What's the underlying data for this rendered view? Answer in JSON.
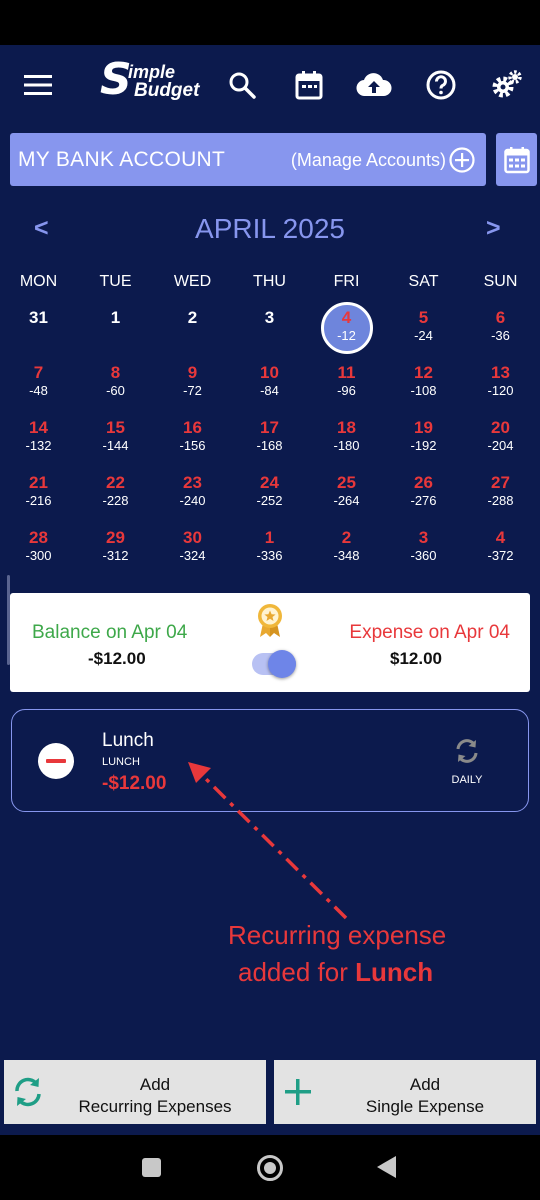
{
  "app": {
    "logo_line1": "imple",
    "logo_line2": "Budget",
    "logo_letter": "S"
  },
  "toolbar": {
    "icons": [
      "menu-icon",
      "search-icon",
      "calendar-icon",
      "cloud-upload-icon",
      "help-icon",
      "settings-icon"
    ]
  },
  "account": {
    "name": "MY BANK ACCOUNT",
    "manage_label": "(Manage Accounts)"
  },
  "calendar": {
    "month_title": "APRIL 2025",
    "prev": "<",
    "next": ">",
    "days_of_week": [
      "MON",
      "TUE",
      "WED",
      "THU",
      "FRI",
      "SAT",
      "SUN"
    ],
    "weeks": [
      [
        {
          "d": "31",
          "a": "",
          "c": "white"
        },
        {
          "d": "1",
          "a": "",
          "c": "white"
        },
        {
          "d": "2",
          "a": "",
          "c": "white"
        },
        {
          "d": "3",
          "a": "",
          "c": "white"
        },
        {
          "d": "4",
          "a": "-12",
          "c": "red",
          "today": true
        },
        {
          "d": "5",
          "a": "-24",
          "c": "red"
        },
        {
          "d": "6",
          "a": "-36",
          "c": "red"
        }
      ],
      [
        {
          "d": "7",
          "a": "-48",
          "c": "red"
        },
        {
          "d": "8",
          "a": "-60",
          "c": "red"
        },
        {
          "d": "9",
          "a": "-72",
          "c": "red"
        },
        {
          "d": "10",
          "a": "-84",
          "c": "red"
        },
        {
          "d": "11",
          "a": "-96",
          "c": "red"
        },
        {
          "d": "12",
          "a": "-108",
          "c": "red"
        },
        {
          "d": "13",
          "a": "-120",
          "c": "red"
        }
      ],
      [
        {
          "d": "14",
          "a": "-132",
          "c": "red"
        },
        {
          "d": "15",
          "a": "-144",
          "c": "red"
        },
        {
          "d": "16",
          "a": "-156",
          "c": "red"
        },
        {
          "d": "17",
          "a": "-168",
          "c": "red"
        },
        {
          "d": "18",
          "a": "-180",
          "c": "red"
        },
        {
          "d": "19",
          "a": "-192",
          "c": "red"
        },
        {
          "d": "20",
          "a": "-204",
          "c": "red"
        }
      ],
      [
        {
          "d": "21",
          "a": "-216",
          "c": "red"
        },
        {
          "d": "22",
          "a": "-228",
          "c": "red"
        },
        {
          "d": "23",
          "a": "-240",
          "c": "red"
        },
        {
          "d": "24",
          "a": "-252",
          "c": "red"
        },
        {
          "d": "25",
          "a": "-264",
          "c": "red"
        },
        {
          "d": "26",
          "a": "-276",
          "c": "red"
        },
        {
          "d": "27",
          "a": "-288",
          "c": "red"
        }
      ],
      [
        {
          "d": "28",
          "a": "-300",
          "c": "red"
        },
        {
          "d": "29",
          "a": "-312",
          "c": "red"
        },
        {
          "d": "30",
          "a": "-324",
          "c": "red"
        },
        {
          "d": "1",
          "a": "-336",
          "c": "red"
        },
        {
          "d": "2",
          "a": "-348",
          "c": "red"
        },
        {
          "d": "3",
          "a": "-360",
          "c": "red"
        },
        {
          "d": "4",
          "a": "-372",
          "c": "red"
        }
      ]
    ]
  },
  "summary": {
    "balance_label": "Balance on Apr 04",
    "balance_value": "-$12.00",
    "expense_label": "Expense on Apr 04",
    "expense_value": "$12.00",
    "toggle_on": true
  },
  "expense_item": {
    "title": "Lunch",
    "category": "LUNCH",
    "amount": "-$12.00",
    "recurrence": "DAILY"
  },
  "annotation": {
    "line1": "Recurring expense",
    "line2_prefix": "added for ",
    "line2_bold": "Lunch"
  },
  "buttons": {
    "recurring_line1": "Add",
    "recurring_line2": "Recurring Expenses",
    "single_line1": "Add",
    "single_line2": "Single Expense"
  },
  "colors": {
    "background": "#0c1a4d",
    "accent": "#8796ee",
    "expense_red": "#e8383b",
    "balance_green": "#3ea84a",
    "teal": "#1f9e86"
  }
}
